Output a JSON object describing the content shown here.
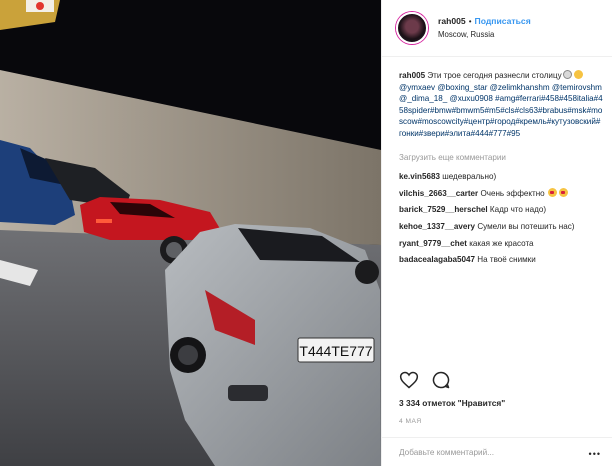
{
  "header": {
    "username": "rah005",
    "separator": "•",
    "follow_label": "Подписаться",
    "location": "Moscow, Russia"
  },
  "caption": {
    "username": "rah005",
    "text": "Эти трое сегодня разнесли столицу",
    "mentions": "@ymxaev @boxing_star @zelimkhanshm @temirovshm @_dima_18_ @xuxu0908",
    "hashtags": "#amg#ferrari#458#458italia#458spider#bmw#bmwm5#m5#cls#cls63#brabus#msk#moscow#moscowcity#центр#город#кремль#кутузовский#гонки#звери#элита#444#777#95"
  },
  "load_more_label": "Загрузить еще комментарии",
  "comments": [
    {
      "user": "ke.vin5683",
      "text": "шедеврально)"
    },
    {
      "user": "vilchis_2663__carter",
      "text": "Очень эффектно"
    },
    {
      "user": "barick_7529__herschel",
      "text": "Кадр что надо)"
    },
    {
      "user": "kehoe_1337__avery",
      "text": "Сумели вы потешить нас)"
    },
    {
      "user": "ryant_9779__chet",
      "text": "какая же красота"
    },
    {
      "user": "badacealagaba5047",
      "text": "На твоё снимки"
    }
  ],
  "photo": {
    "license_plate": "Т444ТЕ777"
  },
  "likes_text": "3 334 отметок \"Нравится\"",
  "date_text": "4 МАЯ",
  "comment_input": {
    "placeholder": "Добавьте комментарий..."
  },
  "icons": [
    "heart-icon",
    "comment-icon",
    "more-options-icon"
  ],
  "colors": {
    "accent": "#3897f0",
    "hashtag": "#003569",
    "muted": "#999999"
  }
}
